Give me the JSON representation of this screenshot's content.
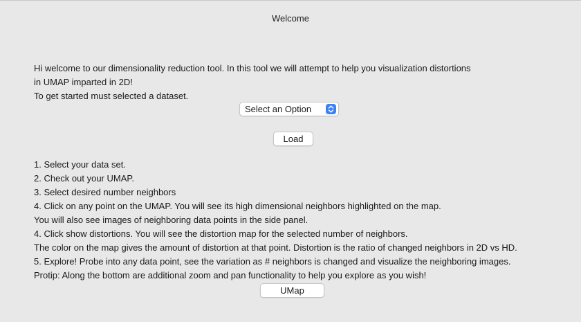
{
  "window": {
    "title": "Welcome"
  },
  "intro": {
    "lines": [
      "Hi welcome to our dimensionality reduction tool. In this tool we will attempt to help you visualization distortions",
      "in UMAP imparted in 2D!",
      "To get started must selected a dataset."
    ]
  },
  "dataset_select": {
    "selected": "Select an Option",
    "icon": "chevron-up-down-icon",
    "accent_color": "#3b82f6"
  },
  "load_button": {
    "label": "Load"
  },
  "instructions": {
    "lines": [
      "1. Select your data set.",
      "2. Check out your UMAP.",
      "3. Select desired number neighbors",
      "4. Click on any point on the UMAP. You will see its high dimensional neighbors highlighted on the map.",
      "You will also see images of neighboring data points in the side panel.",
      "4. Click show distortions. You will see the distortion map for the selected number of neighbors.",
      "The color on the map gives the amount of distortion at that point. Distortion is the ratio of changed neighbors in 2D vs HD.",
      "5. Explore! Probe into any data point, see the variation as # neighbors is changed and visualize the neighboring images.",
      "Protip: Along the bottom are additional zoom and pan functionality to help you explore as you wish!"
    ]
  },
  "umap_button": {
    "label": "UMap"
  }
}
